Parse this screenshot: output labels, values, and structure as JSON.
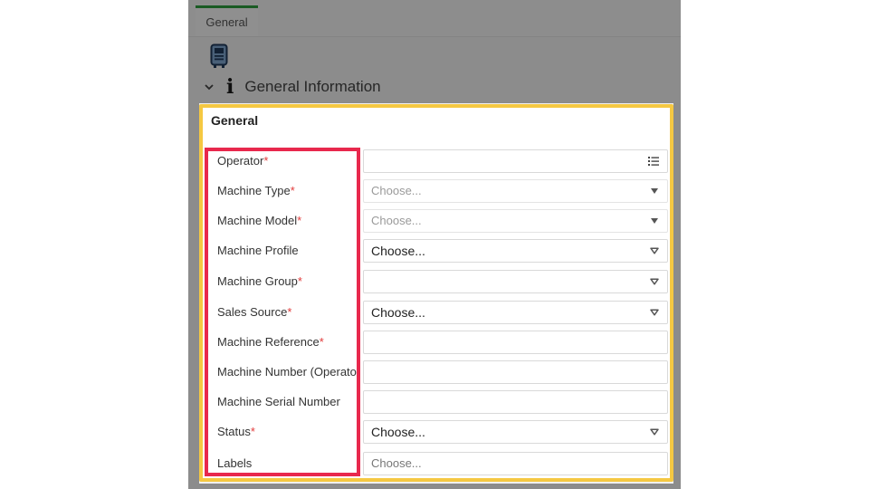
{
  "tabs": [
    {
      "label": "General",
      "active": true
    }
  ],
  "section": {
    "title": "General Information",
    "icon": "info-icon",
    "expanded": true
  },
  "card": {
    "title": "General",
    "fields": [
      {
        "label": "Operator",
        "required": true,
        "control": "lookup",
        "value": "",
        "placeholder": ""
      },
      {
        "label": "Machine Type",
        "required": true,
        "control": "select-disabled",
        "value": "",
        "placeholder": "Choose..."
      },
      {
        "label": "Machine Model",
        "required": true,
        "control": "select-disabled",
        "value": "",
        "placeholder": "Choose..."
      },
      {
        "label": "Machine Profile",
        "required": false,
        "control": "select",
        "value": "Choose...",
        "placeholder": ""
      },
      {
        "label": "Machine Group",
        "required": true,
        "control": "select",
        "value": "",
        "placeholder": ""
      },
      {
        "label": "Sales Source",
        "required": true,
        "control": "select",
        "value": "Choose...",
        "placeholder": ""
      },
      {
        "label": "Machine Reference",
        "required": true,
        "control": "text",
        "value": "",
        "placeholder": ""
      },
      {
        "label": "Machine Number (Operator",
        "required": false,
        "control": "text",
        "value": "",
        "placeholder": ""
      },
      {
        "label": "Machine Serial Number",
        "required": false,
        "control": "text",
        "value": "",
        "placeholder": ""
      },
      {
        "label": "Status",
        "required": true,
        "control": "select",
        "value": "Choose...",
        "placeholder": ""
      },
      {
        "label": "Labels",
        "required": false,
        "control": "tags",
        "value": "",
        "placeholder": "Choose..."
      }
    ]
  },
  "required_marker": "*",
  "colors": {
    "tab_accent": "#2e9e3f",
    "required": "#e23b3b",
    "highlight_outer": "#f5c842",
    "highlight_labels": "#e8284d"
  }
}
